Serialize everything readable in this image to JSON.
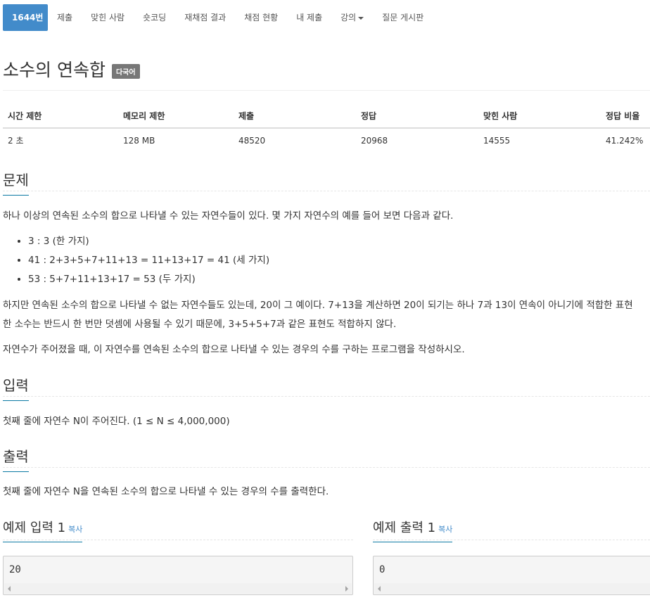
{
  "nav": {
    "items": [
      {
        "label": "1644번",
        "active": true
      },
      {
        "label": "제출"
      },
      {
        "label": "맞힌 사람"
      },
      {
        "label": "숏코딩"
      },
      {
        "label": "재채점 결과"
      },
      {
        "label": "채점 현황"
      },
      {
        "label": "내 제출"
      },
      {
        "label": "강의",
        "dropdown": true
      },
      {
        "label": "질문 게시판"
      }
    ]
  },
  "problem": {
    "title": "소수의 연속합",
    "badge": "다국어"
  },
  "info_table": {
    "headers": [
      "시간 제한",
      "메모리 제한",
      "제출",
      "정답",
      "맞힌 사람",
      "정답 비율"
    ],
    "values": [
      "2 초",
      "128 MB",
      "48520",
      "20968",
      "14555",
      "41.242%"
    ]
  },
  "sections": {
    "problem_head": "문제",
    "problem_intro": "하나 이상의 연속된 소수의 합으로 나타낼 수 있는 자연수들이 있다. 몇 가지 자연수의 예를 들어 보면 다음과 같다.",
    "examples": [
      "3 : 3 (한 가지)",
      "41 : 2+3+5+7+11+13 = 11+13+17 = 41 (세 가지)",
      "53 : 5+7+11+13+17 = 53 (두 가지)"
    ],
    "problem_p2_line1": "하지만 연속된 소수의 합으로 나타낼 수 없는 자연수들도 있는데, 20이 그 예이다. 7+13을 계산하면 20이 되기는 하나 7과 13이 연속이 아니기에 적합한 표현",
    "problem_p2_line2": "한 소수는 반드시 한 번만 덧셈에 사용될 수 있기 때문에, 3+5+5+7과 같은 표현도 적합하지 않다.",
    "problem_p3": "자연수가 주어졌을 때, 이 자연수를 연속된 소수의 합으로 나타낼 수 있는 경우의 수를 구하는 프로그램을 작성하시오.",
    "input_head": "입력",
    "input_text": "첫째 줄에 자연수 N이 주어진다. (1 ≤ N ≤ 4,000,000)",
    "output_head": "출력",
    "output_text": "첫째 줄에 자연수 N을 연속된 소수의 합으로 나타낼 수 있는 경우의 수를 출력한다."
  },
  "samples": {
    "input_head": "예제 입력 1",
    "output_head": "예제 출력 1",
    "copy_label": "복사",
    "input_value": "20",
    "output_value": "0"
  },
  "colors": {
    "accent": "#428bca",
    "heading_underline": "#0b79a3",
    "badge": "#777777"
  }
}
